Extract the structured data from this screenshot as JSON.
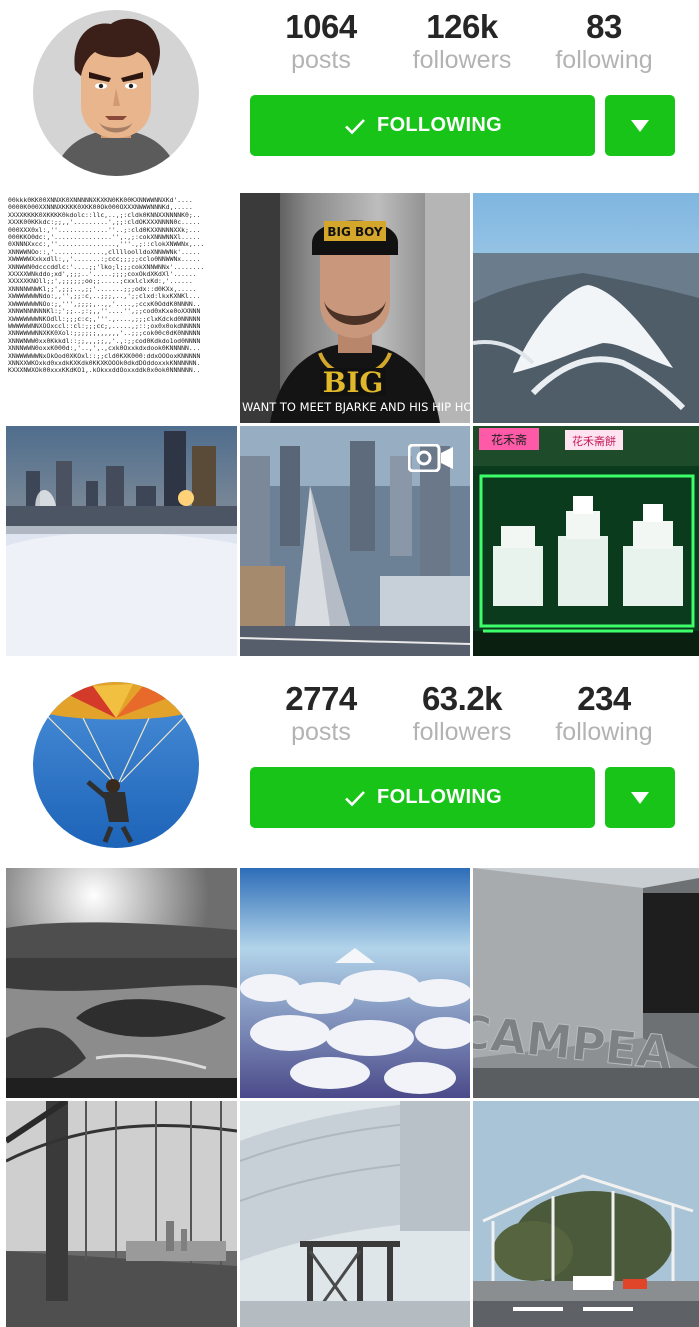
{
  "profiles": [
    {
      "stats": {
        "posts": {
          "value": "1064",
          "label": "posts"
        },
        "followers": {
          "value": "126k",
          "label": "followers"
        },
        "following": {
          "value": "83",
          "label": "following"
        }
      },
      "follow_button_label": "FOLLOWING",
      "photos": [
        {
          "name": "ascii-art-photo"
        },
        {
          "name": "big-portrait-photo",
          "caption": "WANT TO MEET BJARKE AND HIS HIP HO",
          "cap_text": "BIG",
          "hat_text": "BIG BOY"
        },
        {
          "name": "aerial-mountain-photo"
        },
        {
          "name": "city-sunset-snow-photo"
        },
        {
          "name": "pyramid-building-photo"
        },
        {
          "name": "cake-shop-window-photo",
          "sign1": "花禾斋",
          "sign2": "花禾斋餅"
        }
      ]
    },
    {
      "stats": {
        "posts": {
          "value": "2774",
          "label": "posts"
        },
        "followers": {
          "value": "63.2k",
          "label": "followers"
        },
        "following": {
          "value": "234",
          "label": "following"
        }
      },
      "follow_button_label": "FOLLOWING",
      "photos": [
        {
          "name": "bw-islands-photo"
        },
        {
          "name": "clouds-mountain-photo"
        },
        {
          "name": "campeau-building-photo",
          "sign": "CAMPEA"
        },
        {
          "name": "bridge-photo"
        },
        {
          "name": "pipe-structure-photo"
        },
        {
          "name": "pavilion-frame-photo"
        }
      ]
    }
  ],
  "icons": {
    "check": "check-icon",
    "dropdown": "triangle-down-icon",
    "video": "video-camera-icon"
  },
  "colors": {
    "accent_green": "#17c417",
    "stat_label_gray": "#b3b3b3"
  }
}
